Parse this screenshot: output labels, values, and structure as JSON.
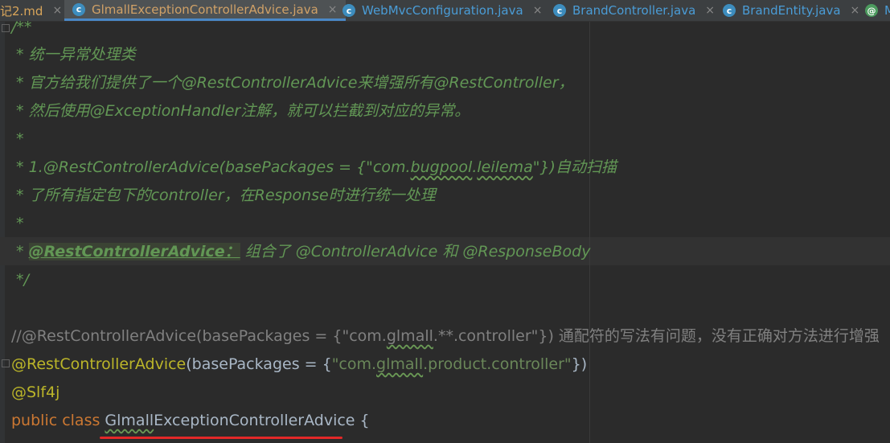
{
  "tabs": [
    {
      "label": "记2.md",
      "icon": "markdown-icon",
      "active": false
    },
    {
      "label": "GlmallExceptionControllerAdvice.java",
      "icon": "class-icon",
      "active": true
    },
    {
      "label": "WebMvcConfiguration.java",
      "icon": "class-icon",
      "active": false
    },
    {
      "label": "BrandController.java",
      "icon": "class-icon",
      "active": false
    },
    {
      "label": "BrandEntity.java",
      "icon": "class-icon",
      "active": false
    },
    {
      "label": "M",
      "icon": "module-icon",
      "active": false
    }
  ],
  "tab_close": "×",
  "code": {
    "l1": "/**",
    "l2": " * 统一异常处理类",
    "l3": " * 官方给我们提供了一个@RestControllerAdvice来增强所有@RestController，",
    "l4": " * 然后使用@ExceptionHandler注解，就可以拦截到对应的异常。",
    "l5": " *",
    "l6a": " * 1.@RestControllerAdvice(basePackages = {\"com.",
    "l6b": "bugpool",
    "l6c": ".",
    "l6d": "leilema",
    "l6e": "\"})自动扫描",
    "l7": " * 了所有指定包下的controller，在Response时进行统一处理",
    "l8": " *",
    "l9a": " * ",
    "l9b": "@RestControllerAdvice：",
    "l9c": " 组合了 @ControllerAdvice 和 @ResponseBody",
    "l10": " */",
    "l12a": "//@RestControllerAdvice(basePackages = {\"com.",
    "l12b": "glmall",
    "l12c": ".**.controller\"}) 通配符的写法有问题，没有正确对方法进行增强",
    "l13a": "@RestControllerAdvice",
    "l13b": "(basePackages = {",
    "l13c": "\"com.",
    "l13d": "glmall",
    "l13e": ".product.controller\"",
    "l13f": "})",
    "l14": "@Slf4j",
    "l15a": "public class ",
    "l15b": "Glmall",
    "l15c": "ExceptionControllerAdvice",
    "l15d": " {"
  },
  "colors": {
    "background": "#2b2b2b",
    "comment": "#629755",
    "annotation": "#bbb529",
    "keyword": "#cc7832",
    "string": "#6a8759",
    "text": "#a9b7c6",
    "underline_red": "#e32828"
  }
}
